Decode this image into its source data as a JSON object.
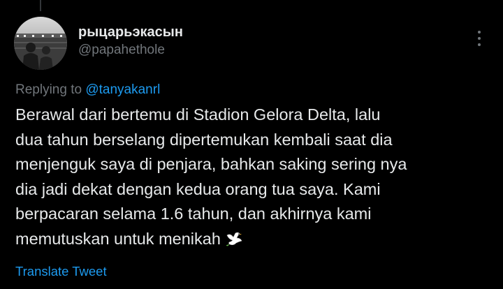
{
  "author": {
    "display_name": "рыцарьэкасын",
    "handle": "@papahethole",
    "avatar_icon": "profile-photo"
  },
  "reply_context": {
    "prefix": "Replying to",
    "mention": "@tanyakanrl"
  },
  "tweet": {
    "lines": [
      "Berawal dari bertemu di Stadion Gelora Delta, lalu",
      "dua tahun berselang dipertemukan kembali saat dia",
      "menjenguk saya di penjara, bahkan saking sering nya",
      "dia jadi dekat dengan kedua orang tua saya. Kami",
      "berpacaran selama 1.6 tahun, dan akhirnya kami",
      "memutuskan untuk menikah"
    ],
    "emoji": "dove-icon"
  },
  "actions": {
    "translate_label": "Translate Tweet",
    "more_icon": "more-options-icon"
  },
  "colors": {
    "background": "#000000",
    "text": "#e7e9ea",
    "muted": "#71767b",
    "link": "#1d9bf0"
  }
}
